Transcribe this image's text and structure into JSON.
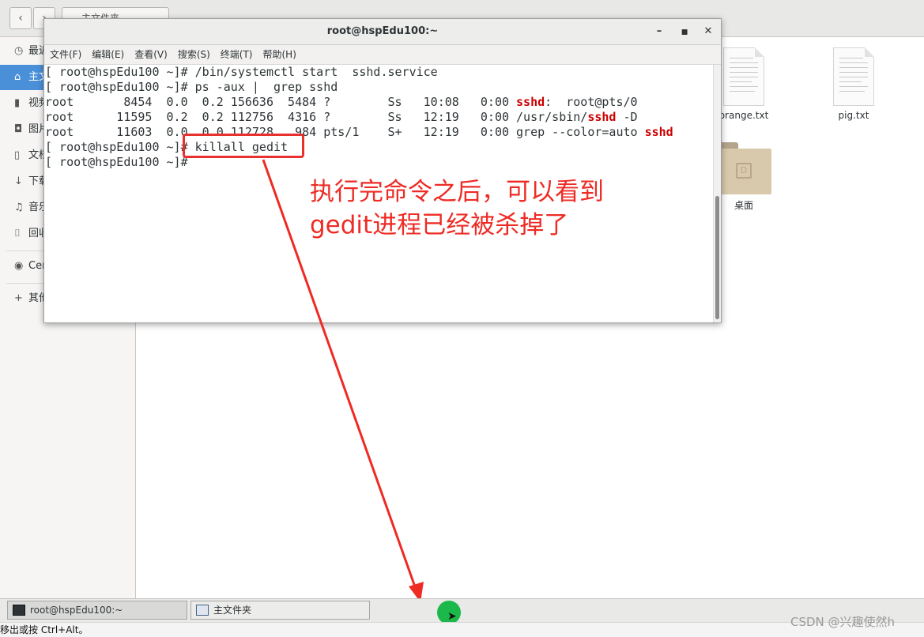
{
  "file_manager": {
    "pathbar_label": "主文件夹",
    "nav_back": "‹",
    "nav_forward": "›",
    "sidebar": [
      {
        "icon": "clock-icon",
        "glyph": "◷",
        "label": "最近使用"
      },
      {
        "icon": "home-icon",
        "glyph": "⌂",
        "label": "主文件夹",
        "active": true
      },
      {
        "icon": "video-icon",
        "glyph": "▮",
        "label": "视频"
      },
      {
        "icon": "camera-icon",
        "glyph": "◘",
        "label": "图片"
      },
      {
        "icon": "document-icon",
        "glyph": "▯",
        "label": "文档"
      },
      {
        "icon": "download-icon",
        "glyph": "↓",
        "label": "下载"
      },
      {
        "icon": "music-icon",
        "glyph": "♫",
        "label": "音乐"
      },
      {
        "icon": "trash-icon",
        "glyph": "⌷",
        "label": "回收站"
      },
      {
        "icon": "disc-icon",
        "glyph": "◉",
        "label": "CentOS"
      },
      {
        "icon": "plus-icon",
        "glyph": "+",
        "label": "其他位置"
      }
    ],
    "files": [
      {
        "name": "orange.txt",
        "type": "text"
      },
      {
        "name": "pig.txt",
        "type": "text"
      },
      {
        "name": "桌面",
        "type": "folder"
      }
    ]
  },
  "terminal": {
    "title": "root@hspEdu100:~",
    "menu": [
      "文件(F)",
      "编辑(E)",
      "查看(V)",
      "搜索(S)",
      "终端(T)",
      "帮助(H)"
    ],
    "lines": [
      "[ root@hspEdu100 ~]# /bin/systemctl start  sshd.service",
      "[ root@hspEdu100 ~]# ps -aux |  grep sshd",
      "root       8454  0.0  0.2 156636  5484 ?        Ss   10:08   0:00 sshd:  root@pts/0",
      "root      11595  0.2  0.2 112756  4316 ?        Ss   12:19   0:00 /usr/sbin/sshd -D",
      "root      11603  0.0  0.0 112728   984 pts/1    S+   12:19   0:00 grep --color=auto sshd",
      "[ root@hspEdu100 ~]# killall gedit",
      "[ root@hspEdu100 ~]#"
    ],
    "highlight_color": "#cc0000"
  },
  "annotation": {
    "line1": "执行完命令之后，可以看到",
    "line2": "gedit进程已经被杀掉了",
    "color": "#ee2b24"
  },
  "taskbar": {
    "items": [
      "root@hspEdu100:~",
      "主文件夹"
    ]
  },
  "status_text": "移出或按 Ctrl+Alt。",
  "watermark": "CSDN @兴趣使然h"
}
